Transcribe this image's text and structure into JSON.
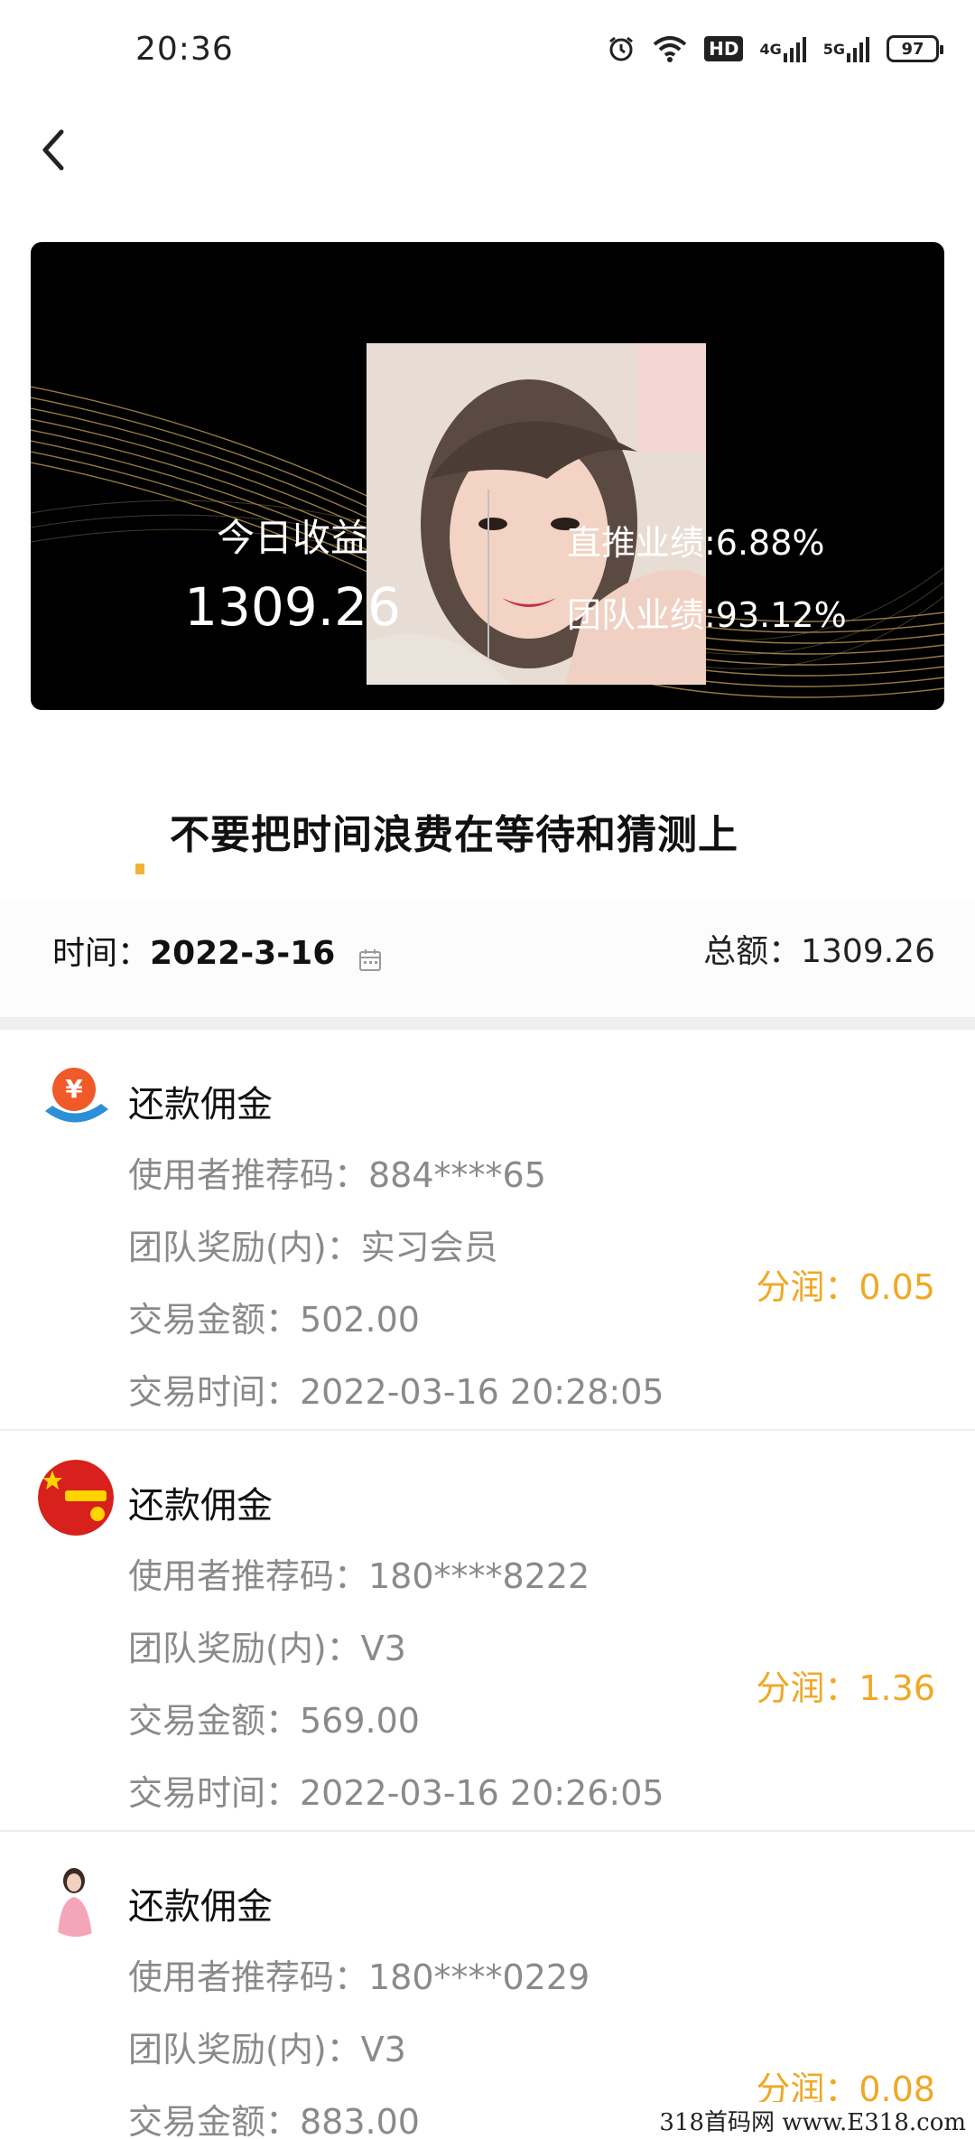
{
  "status_bar": {
    "time": "20:36",
    "hd_label": "HD",
    "net1_label": "4G",
    "net2_label": "5G",
    "battery": "97"
  },
  "hero": {
    "today_label": "今日收益",
    "today_value": "1309.26",
    "direct_metric": "直推业绩:6.88%",
    "team_metric": "团队业绩:93.12%"
  },
  "banner": {
    "text": "不要把时间浪费在等待和猜测上"
  },
  "filter": {
    "time_label": "时间：",
    "date": "2022-3-16",
    "total_label": "总额：",
    "total_value": "1309.26"
  },
  "records": [
    {
      "title": "还款佣金",
      "referral": "使用者推荐码：884****65",
      "reward": "团队奖励(内)：实习会员",
      "amount": "交易金额：502.00",
      "time": "交易时间：2022-03-16 20:28:05",
      "share": "分润：0.05",
      "icon": "yuan-coin-icon"
    },
    {
      "title": "还款佣金",
      "referral": "使用者推荐码：180****8222",
      "reward": "团队奖励(内)：V3",
      "amount": "交易金额：569.00",
      "time": "交易时间：2022-03-16 20:26:05",
      "share": "分润：1.36",
      "icon": "flag-avatar-icon"
    },
    {
      "title": "还款佣金",
      "referral": "使用者推荐码：180****0229",
      "reward": "团队奖励(内)：V3",
      "amount": "交易金额：883.00",
      "time": "",
      "share": "分润：0.08",
      "icon": "person-avatar-icon"
    }
  ],
  "watermark": "318首码网 www.E318.com",
  "colors": {
    "accent": "#f0a825",
    "card_bg": "#000000",
    "gold_line": "#c9a45c"
  }
}
